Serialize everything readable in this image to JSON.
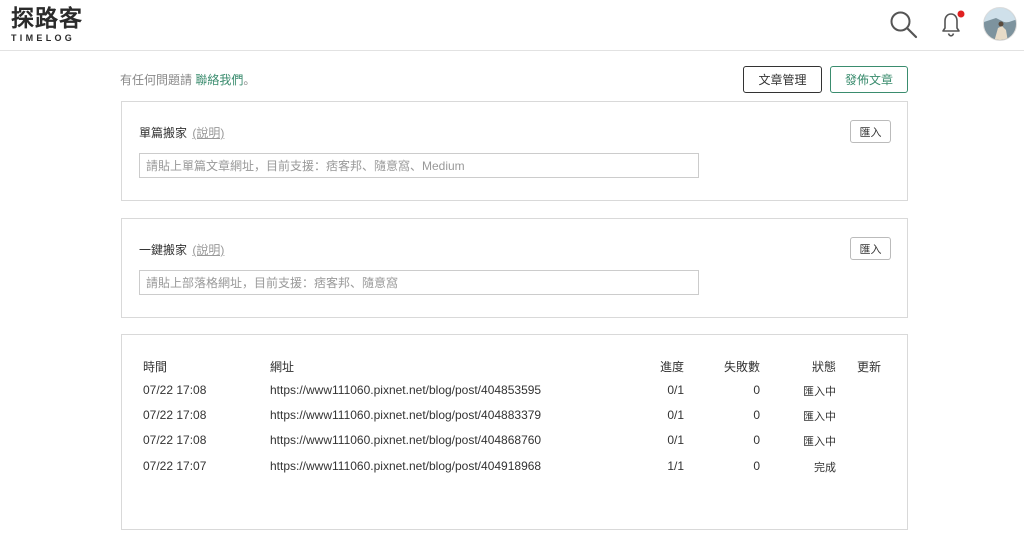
{
  "header": {
    "logo_cn": "探路客",
    "logo_en": "TIMELOG",
    "search_icon": "search-icon",
    "bell_icon": "bell-icon",
    "notification_dot_color": "#e02020"
  },
  "topbar": {
    "contact_prefix": "有任何問題請",
    "contact_link": "聯絡我們",
    "contact_suffix": "。",
    "manage_label": "文章管理",
    "publish_label": "發佈文章"
  },
  "single": {
    "title": "單篇搬家",
    "help": "(說明)",
    "import_label": "匯入",
    "placeholder": "請貼上單篇文章網址，目前支援：痞客邦、隨意窩、Medium"
  },
  "oneclick": {
    "title": "一鍵搬家",
    "help": "(說明)",
    "import_label": "匯入",
    "placeholder": "請貼上部落格網址，目前支援：痞客邦、隨意窩"
  },
  "table": {
    "headers": {
      "time": "時間",
      "url": "網址",
      "progress": "進度",
      "failed": "失敗數",
      "status": "狀態",
      "update": "更新"
    },
    "rows": [
      {
        "time": "07/22 17:08",
        "url": "https://www111060.pixnet.net/blog/post/404853595",
        "progress": "0/1",
        "failed": "0",
        "status": "匯入中"
      },
      {
        "time": "07/22 17:08",
        "url": "https://www111060.pixnet.net/blog/post/404883379",
        "progress": "0/1",
        "failed": "0",
        "status": "匯入中"
      },
      {
        "time": "07/22 17:08",
        "url": "https://www111060.pixnet.net/blog/post/404868760",
        "progress": "0/1",
        "failed": "0",
        "status": "匯入中"
      },
      {
        "time": "07/22 17:07",
        "url": "https://www111060.pixnet.net/blog/post/404918968",
        "progress": "1/1",
        "failed": "0",
        "status": "完成"
      }
    ]
  }
}
